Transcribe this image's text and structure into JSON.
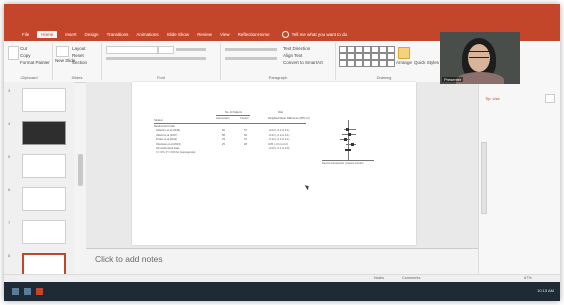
{
  "ribbon_tabs": [
    "File",
    "Home",
    "Insert",
    "Design",
    "Transitions",
    "Animations",
    "Slide Show",
    "Review",
    "View",
    "ReflectionHome"
  ],
  "tell_me": "Tell me what you want to do",
  "ribbon": {
    "paste_label": "Paste",
    "clipboard_items": [
      "Cut",
      "Copy",
      "Format Painter"
    ],
    "clipboard_group": "Clipboard",
    "new_slide_label": "New Slide",
    "slide_items": [
      "Layout",
      "Reset",
      "Section"
    ],
    "slides_group": "Slides",
    "font_group": "Font",
    "paragraph_items": [
      "Text Direction",
      "Align Text",
      "Convert to SmartArt"
    ],
    "paragraph_group": "Paragraph",
    "arrange_label": "Arrange",
    "quick_styles_label": "Quick Styles",
    "drawing_group": "Drawing"
  },
  "thumbnails": [
    {
      "num": "3",
      "style": "light"
    },
    {
      "num": "4",
      "style": "dark"
    },
    {
      "num": "5",
      "style": "light"
    },
    {
      "num": "6",
      "style": "light"
    },
    {
      "num": "7",
      "style": "light"
    },
    {
      "num": "8",
      "style": "selected"
    }
  ],
  "slide_content": {
    "col_header_1": "No. of Patients",
    "col_sub_1": "Intervention",
    "col_sub_2": "Control",
    "col_header_2": "Risk",
    "col_sub_3": "Weighted Mean Difference (95% CI)",
    "row_label_head": "Stratum",
    "group_label": "Randomized trials",
    "rows": [
      {
        "label": "Ahlström et al (2016)",
        "n1": "60",
        "n2": "57",
        "ci": "−0.04 (−0.2 to 0.1)"
      },
      {
        "label": "Abbott et al (2017)",
        "n1": "58",
        "n2": "60",
        "ci": "−0.02 (−0.2 to 0.1)"
      },
      {
        "label": "Fridén et al (2011)",
        "n1": "33",
        "n2": "31",
        "ci": "−0.10 (−0.3 to 0.1)"
      },
      {
        "label": "Okonkwo et al (2013)",
        "n1": "25",
        "n2": "28",
        "ci": "0.05 (−0.1 to 0.2)"
      }
    ],
    "pooled_label": "All randomized trials",
    "pooled_ci": "−0.03 (−0.1 to 0.0)",
    "het_label": "I² = 0%; P = 0.60 for heterogeneity",
    "axis_label": "Favors Intervention | Favors Control"
  },
  "notes_placeholder": "Click to add notes",
  "presenter_name": "Presenter",
  "right_pane": {
    "label": "Tip: Use",
    "ctrl": "›"
  },
  "status": {
    "notes": "Notes",
    "comments": "Comments",
    "zoom": "67%"
  },
  "taskbar_time": "10:15 AM",
  "colors": {
    "accent": "#c3462a"
  }
}
